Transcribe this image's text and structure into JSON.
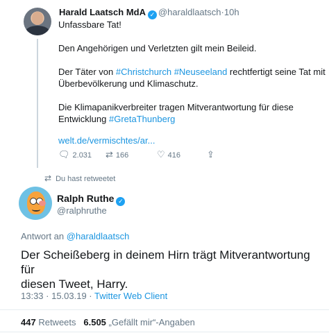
{
  "tweet1": {
    "display_name": "Harald Laatsch MdA",
    "handle": "@haraldlaatsch",
    "separator": "·",
    "time": "10h",
    "line1": "Unfassbare Tat!",
    "line2": "Den Angehörigen und Verletzten gilt mein Beileid.",
    "line3_pre": "Der Täter von ",
    "hashtag1": "#Christchurch",
    "hashtag2": "#Neuseeland",
    "line3_post": " rechtfertigt seine Tat mit",
    "line3b": "Überbevölkerung und Klimaschutz.",
    "line4a": "Die Klimapanikverbreiter tragen Mitverantwortung für diese",
    "line4b_pre": "Entwicklung ",
    "hashtag3": "#GretaThunberg",
    "link": "welt.de/vermischtes/ar...",
    "replies": "2.031",
    "retweets": "166",
    "likes": "416"
  },
  "retweet_notice": "Du hast retweetet",
  "tweet2": {
    "display_name": "Ralph Ruthe",
    "handle": "@ralphruthe",
    "reply_to_label": "Antwort an",
    "reply_to_handle": "@haraldlaatsch",
    "text_line1": "Der Scheißeberg in deinem Hirn trägt Mitverantwortung für",
    "text_line2": "diesen Tweet, Harry.",
    "timestamp": "13:33 · 15.03.19 · ",
    "client": "Twitter Web Client",
    "retweets_count": "447",
    "retweets_label": "Retweets",
    "likes_count": "6.505",
    "likes_label": "„Gefällt mir“-Angaben"
  },
  "icons": {
    "reply": "reply-icon",
    "retweet": "retweet-icon",
    "like": "heart-icon",
    "share": "share-icon",
    "verified": "verified-icon"
  },
  "colors": {
    "link": "#1b95e0",
    "muted": "#657786",
    "verified": "#1da1f2"
  }
}
